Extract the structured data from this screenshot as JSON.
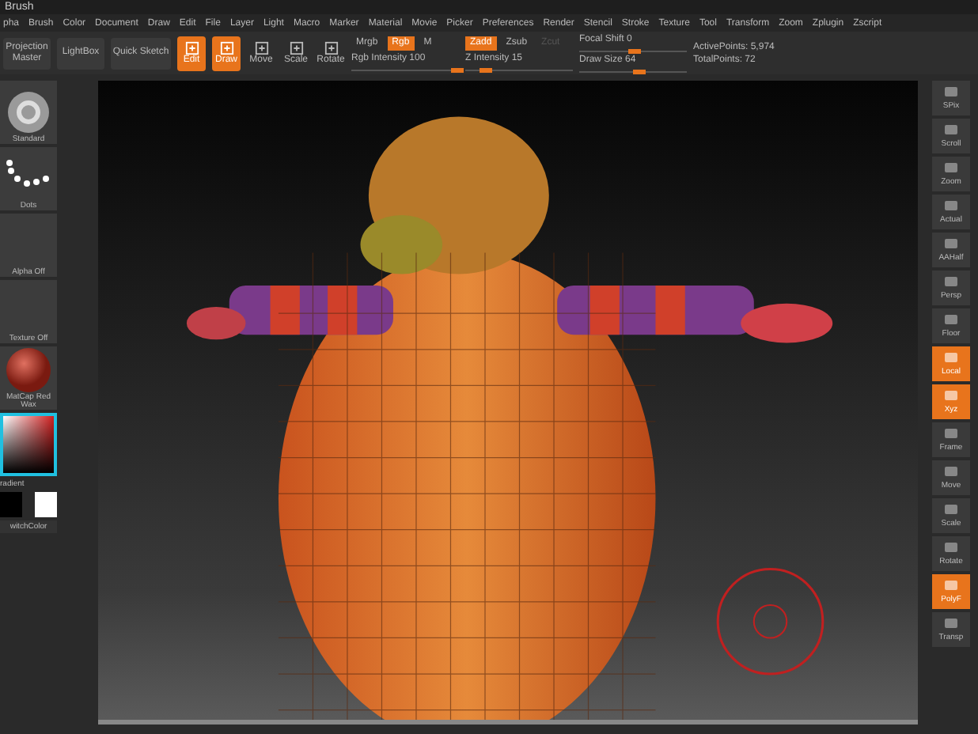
{
  "window": {
    "title": "Brush"
  },
  "menu": [
    "pha",
    "Brush",
    "Color",
    "Document",
    "Draw",
    "Edit",
    "File",
    "Layer",
    "Light",
    "Macro",
    "Marker",
    "Material",
    "Movie",
    "Picker",
    "Preferences",
    "Render",
    "Stencil",
    "Stroke",
    "Texture",
    "Tool",
    "Transform",
    "Zoom",
    "Zplugin",
    "Zscript"
  ],
  "toolbar": {
    "panels": [
      "Projection Master",
      "LightBox"
    ],
    "quick_sketch": "Quick Sketch",
    "modes": [
      {
        "label": "Edit",
        "selected": true
      },
      {
        "label": "Draw",
        "selected": true
      },
      {
        "label": "Move",
        "selected": false
      },
      {
        "label": "Scale",
        "selected": false
      },
      {
        "label": "Rotate",
        "selected": false
      }
    ],
    "rgb_modes": [
      {
        "label": "Mrgb",
        "selected": false
      },
      {
        "label": "Rgb",
        "selected": true
      },
      {
        "label": "M",
        "selected": false
      }
    ],
    "z_modes": [
      {
        "label": "Zadd",
        "selected": true,
        "disabled": false
      },
      {
        "label": "Zsub",
        "selected": false,
        "disabled": false
      },
      {
        "label": "Zcut",
        "selected": false,
        "disabled": true
      }
    ],
    "sliders": [
      {
        "label": "Rgb Intensity",
        "value": "100",
        "level": 1.0
      },
      {
        "label": "Z Intensity",
        "value": "15",
        "level": 0.15
      },
      {
        "label": "Focal Shift",
        "value": "0",
        "level": 0.5
      },
      {
        "label": "Draw Size",
        "value": "64",
        "level": 0.55
      }
    ],
    "stats": [
      "ActivePoints: 5,974",
      "TotalPoints: 72"
    ]
  },
  "left_shelf": [
    {
      "kind": "brush",
      "label": "Standard"
    },
    {
      "kind": "stroke",
      "label": "Dots"
    },
    {
      "kind": "empty",
      "label": "Alpha Off"
    },
    {
      "kind": "empty",
      "label": "Texture Off"
    },
    {
      "kind": "material",
      "label": "MatCap Red Wax"
    }
  ],
  "color": {
    "gradient_label": "radient",
    "switch_label": "witchColor"
  },
  "right_shelf": [
    {
      "label": "SPix",
      "selected": false
    },
    {
      "label": "Scroll",
      "selected": false
    },
    {
      "label": "Zoom",
      "selected": false
    },
    {
      "label": "Actual",
      "selected": false
    },
    {
      "label": "AAHalf",
      "selected": false
    },
    {
      "label": "Persp",
      "selected": false
    },
    {
      "label": "Floor",
      "selected": false
    },
    {
      "label": "Local",
      "selected": true
    },
    {
      "label": "Xyz",
      "selected": true
    },
    {
      "label": "Frame",
      "selected": false
    },
    {
      "label": "Move",
      "selected": false
    },
    {
      "label": "Scale",
      "selected": false
    },
    {
      "label": "Rotate",
      "selected": false
    },
    {
      "label": "PolyF",
      "selected": true
    },
    {
      "label": "Transp",
      "selected": false
    }
  ]
}
